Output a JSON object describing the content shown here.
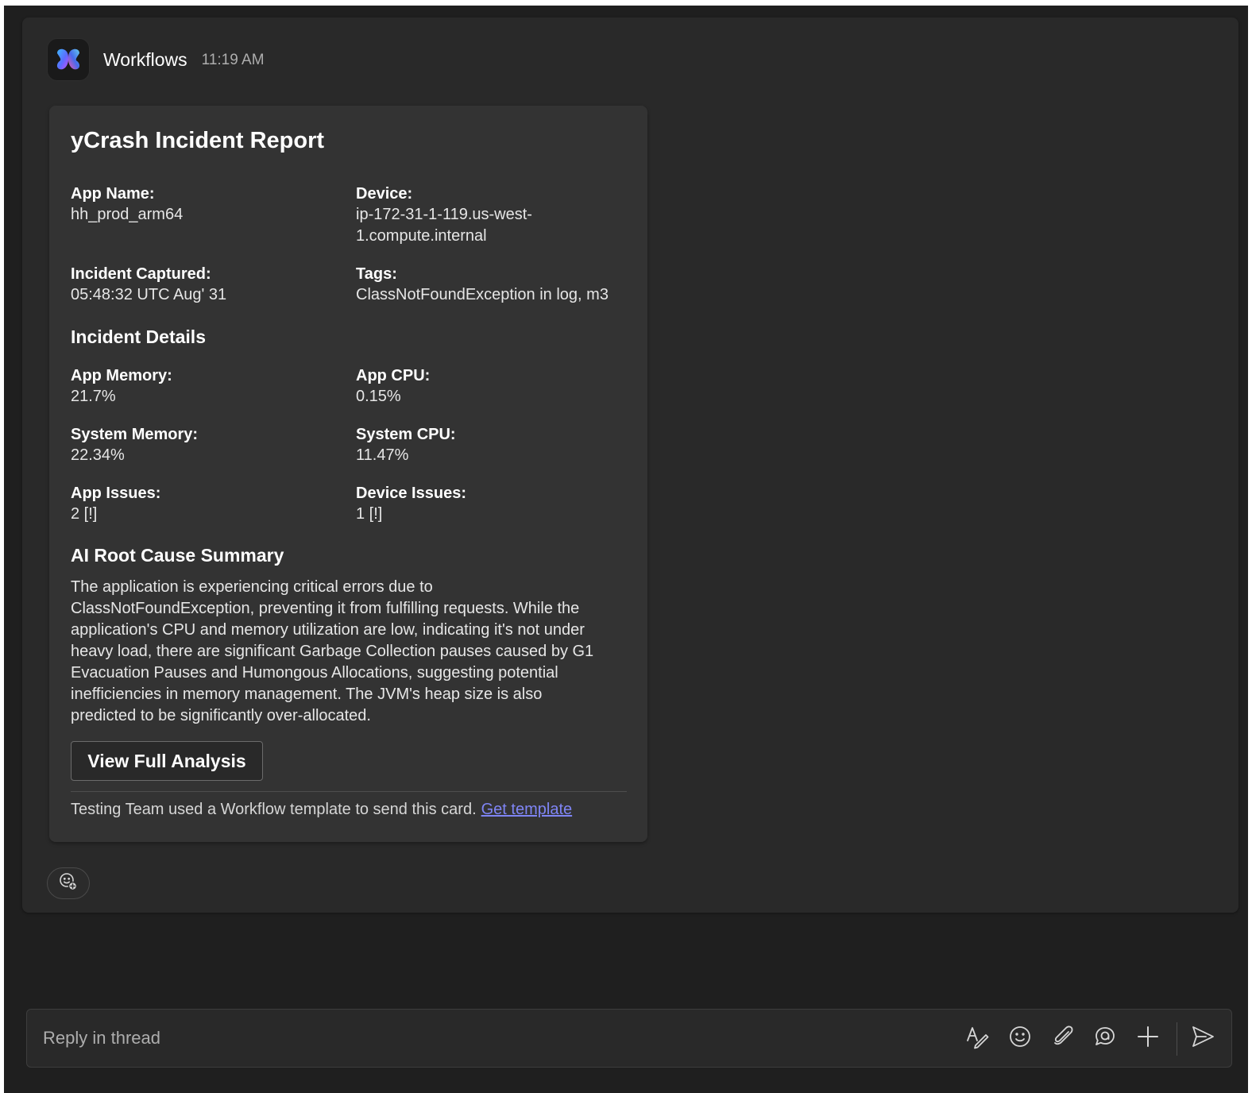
{
  "message": {
    "sender": "Workflows",
    "time": "11:19 AM"
  },
  "card": {
    "title": "yCrash Incident Report",
    "fields": {
      "app_name": {
        "label": "App Name:",
        "value": "hh_prod_arm64"
      },
      "device": {
        "label": "Device:",
        "value_line1": "ip-172-31-1-119.us-west-",
        "value_line2": "1.compute.internal"
      },
      "incident_captured": {
        "label": "Incident Captured:",
        "value": "05:48:32 UTC Aug' 31"
      },
      "tags": {
        "label": "Tags:",
        "value": "ClassNotFoundException in log, m3"
      }
    },
    "details_heading": "Incident Details",
    "details": {
      "app_memory": {
        "label": "App Memory:",
        "value": "21.7%"
      },
      "app_cpu": {
        "label": "App CPU:",
        "value": "0.15%"
      },
      "system_memory": {
        "label": "System Memory:",
        "value": "22.34%"
      },
      "system_cpu": {
        "label": "System CPU:",
        "value": "11.47%"
      },
      "app_issues": {
        "label": "App Issues:",
        "value": "2 [!]"
      },
      "device_issues": {
        "label": "Device Issues:",
        "value": "1 [!]"
      }
    },
    "summary_heading": "AI Root Cause Summary",
    "summary_lines": [
      "The application is experiencing critical errors due to",
      "ClassNotFoundException, preventing it from fulfilling requests. While the",
      "application's CPU and memory utilization are low, indicating it's not under",
      "heavy load, there are significant Garbage Collection pauses caused by G1",
      "Evacuation Pauses and Humongous Allocations, suggesting potential",
      "inefficiencies in memory management. The JVM's heap size is also",
      "predicted to be significantly over-allocated."
    ],
    "button_label": "View Full Analysis",
    "footer_text": "Testing Team used a Workflow template to send this card.",
    "footer_link": "Get template"
  },
  "reply": {
    "placeholder": "Reply in thread"
  },
  "icons": {
    "app": "workflows-logo-icon",
    "reaction": "add-reaction-icon",
    "format": "format-text-icon",
    "emoji": "emoji-icon",
    "attach": "attach-icon",
    "loop": "loop-component-icon",
    "plus": "plus-icon",
    "send": "send-icon"
  },
  "colors": {
    "background": "#1f1f1f",
    "surface": "#292929",
    "card": "#333333",
    "link": "#7f85f5",
    "text": "#ffffff"
  }
}
